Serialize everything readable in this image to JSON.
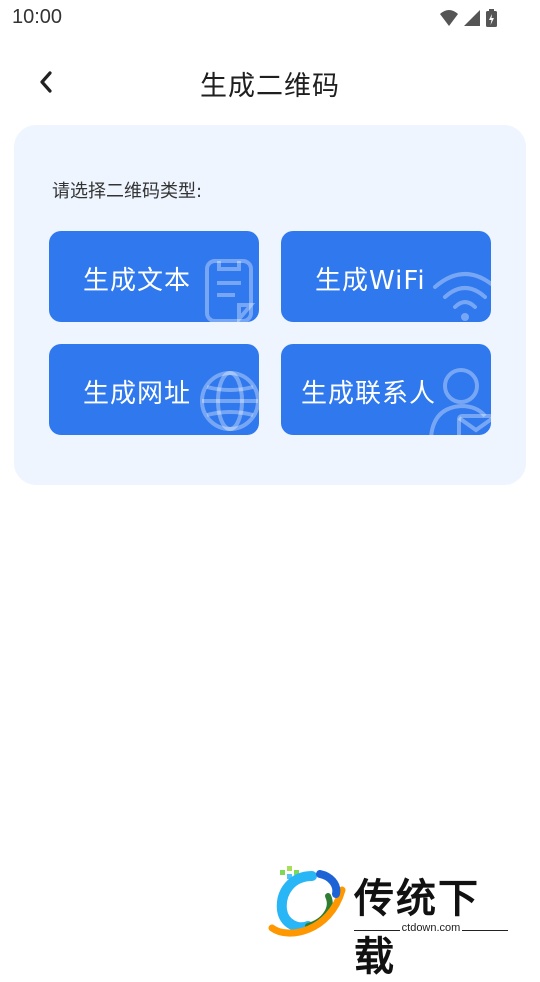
{
  "status_bar": {
    "time": "10:00",
    "icons": [
      "wifi-icon",
      "signal-icon",
      "battery-charging-icon"
    ]
  },
  "header": {
    "title": "生成二维码",
    "back_icon": "chevron-left-icon"
  },
  "card": {
    "prompt": "请选择二维码类型:",
    "tiles": [
      {
        "label": "生成文本",
        "icon": "note-icon"
      },
      {
        "label": "生成WiFi",
        "icon": "wifi-icon"
      },
      {
        "label": "生成网址",
        "icon": "globe-icon"
      },
      {
        "label": "生成联系人",
        "icon": "contact-icon"
      }
    ]
  },
  "watermark": {
    "brand": "传统下载",
    "domain": "ctdown.com"
  },
  "colors": {
    "tile": "#2f78ee",
    "card_bg": "#eef5ff",
    "text": "#1f1f1f"
  }
}
